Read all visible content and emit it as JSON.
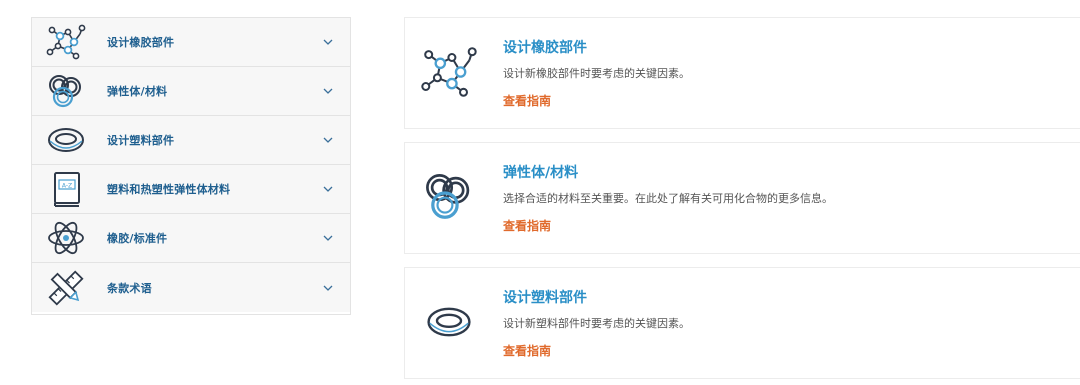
{
  "menu": {
    "items": [
      {
        "label": "设计橡胶部件",
        "icon": "molecule-icon"
      },
      {
        "label": "弹性体/材料",
        "icon": "orings-icon"
      },
      {
        "label": "设计塑料部件",
        "icon": "ring-icon"
      },
      {
        "label": "塑料和热塑性弹性体材料",
        "icon": "book-icon"
      },
      {
        "label": "橡胶/标准件",
        "icon": "atom-icon"
      },
      {
        "label": "条款术语",
        "icon": "pencil-ruler-icon"
      }
    ]
  },
  "cards": [
    {
      "title": "设计橡胶部件",
      "desc": "设计新橡胶部件时要考虑的关键因素。",
      "link": "查看指南",
      "icon": "molecule-icon"
    },
    {
      "title": "弹性体/材料",
      "desc": "选择合适的材料至关重要。在此处了解有关可用化合物的更多信息。",
      "link": "查看指南",
      "icon": "orings-icon"
    },
    {
      "title": "设计塑料部件",
      "desc": "设计新塑料部件时要考虑的关键因素。",
      "link": "查看指南",
      "icon": "ring-icon"
    }
  ],
  "colors": {
    "title": "#2a8fc7",
    "menu_label": "#1f5f8f",
    "link": "#e06a2c",
    "icon_dark": "#2f3a4a",
    "icon_accent": "#4a9fd0"
  }
}
